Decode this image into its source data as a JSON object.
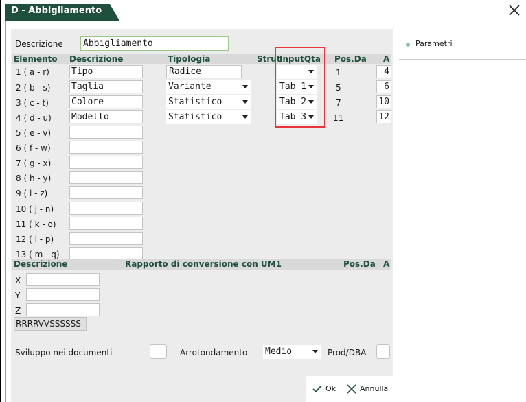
{
  "window": {
    "title": "D - Abbigliamento",
    "close_icon": "close-icon"
  },
  "form": {
    "descrizione_label": "Descrizione",
    "descrizione_value": "Abbigliamento"
  },
  "table": {
    "headers": {
      "elemento": "Elemento",
      "descrizione": "Descrizione",
      "tipologia": "Tipologia",
      "strut": "Strut",
      "inputqta": "InputQta",
      "posda": "Pos.Da",
      "a": "A"
    },
    "rows": [
      {
        "label": "1 ( a - r)",
        "descr": "Tipo",
        "tipologia": "Radice",
        "inputqta": "",
        "posda": "1",
        "a": "4"
      },
      {
        "label": "2 ( b - s)",
        "descr": "Taglia",
        "tipologia": "Variante",
        "inputqta": "Tab 1",
        "posda": "5",
        "a": "6"
      },
      {
        "label": "3 ( c - t)",
        "descr": "Colore",
        "tipologia": "Statistico",
        "inputqta": "Tab 2",
        "posda": "7",
        "a": "10"
      },
      {
        "label": "4 ( d - u)",
        "descr": "Modello",
        "tipologia": "Statistico",
        "inputqta": "Tab 3",
        "posda": "11",
        "a": "12"
      },
      {
        "label": "5 ( e - v)",
        "descr": ""
      },
      {
        "label": "6 ( f - w)",
        "descr": ""
      },
      {
        "label": "7 ( g - x)",
        "descr": ""
      },
      {
        "label": "8 ( h - y)",
        "descr": ""
      },
      {
        "label": "9 ( i - z)",
        "descr": ""
      },
      {
        "label": "10 ( j - n)",
        "descr": ""
      },
      {
        "label": "11 ( k - o)",
        "descr": ""
      },
      {
        "label": "12 ( l - p)",
        "descr": ""
      },
      {
        "label": "13 ( m - q)",
        "descr": ""
      }
    ]
  },
  "conversion": {
    "headers": {
      "descrizione": "Descrizione",
      "rapporto": "Rapporto di conversione con UM1",
      "posda": "Pos.Da",
      "a": "A"
    },
    "rows": [
      {
        "label": "X",
        "value": ""
      },
      {
        "label": "Y",
        "value": ""
      },
      {
        "label": "Z",
        "value": ""
      }
    ],
    "pattern": "RRRRVVSSSSSS"
  },
  "footer": {
    "sviluppo_label": "Sviluppo nei documenti",
    "arrotondamento_label": "Arrotondamento",
    "arrotondamento_value": "Medio",
    "prod_label": "Prod/DBA"
  },
  "sidebar": {
    "parametri": "Parametri"
  },
  "buttons": {
    "ok": "Ok",
    "annulla": "Annulla"
  },
  "colors": {
    "accent": "#1f4f3d",
    "highlight_box": "#e8343a"
  }
}
